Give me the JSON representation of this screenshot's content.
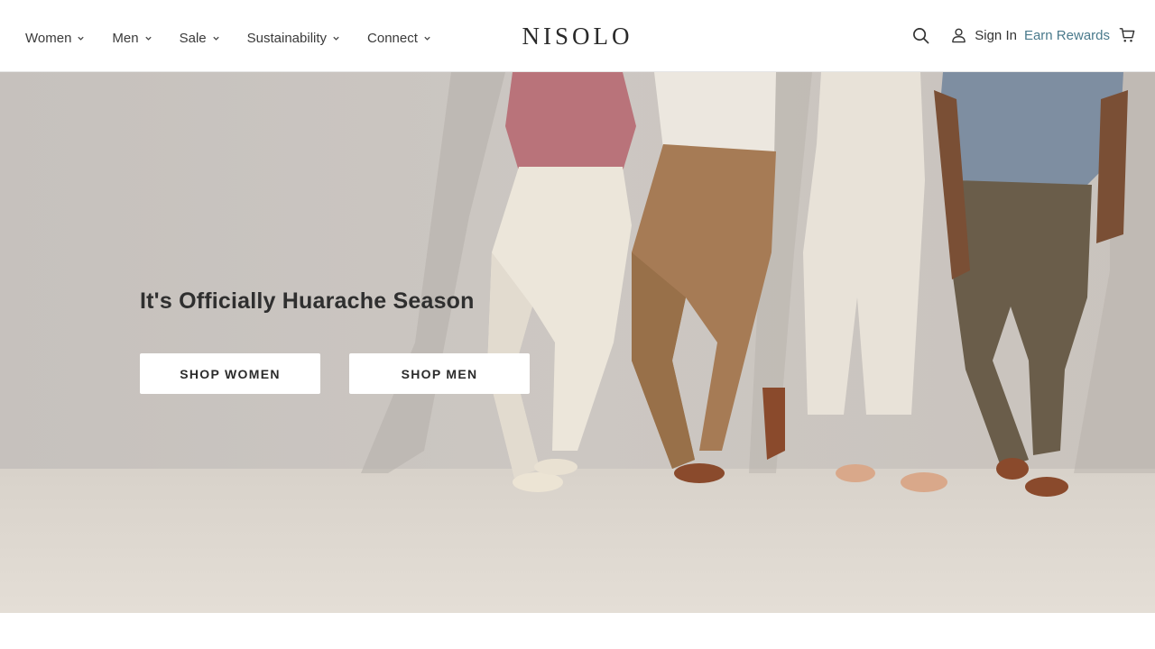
{
  "header": {
    "nav": [
      {
        "label": "Women"
      },
      {
        "label": "Men"
      },
      {
        "label": "Sale"
      },
      {
        "label": "Sustainability"
      },
      {
        "label": "Connect"
      }
    ],
    "logo": "NISOLO",
    "sign_in": "Sign In",
    "earn_rewards": "Earn Rewards"
  },
  "hero": {
    "title": "It's Officially Huarache Season",
    "shop_women": "SHOP WOMEN",
    "shop_men": "SHOP MEN"
  },
  "colors": {
    "rewards_link": "#4a7a8c",
    "text": "#333333",
    "hero_bg": "#cdc8c3"
  },
  "icons": [
    "chevron-down-icon",
    "search-icon",
    "user-icon",
    "cart-icon"
  ]
}
